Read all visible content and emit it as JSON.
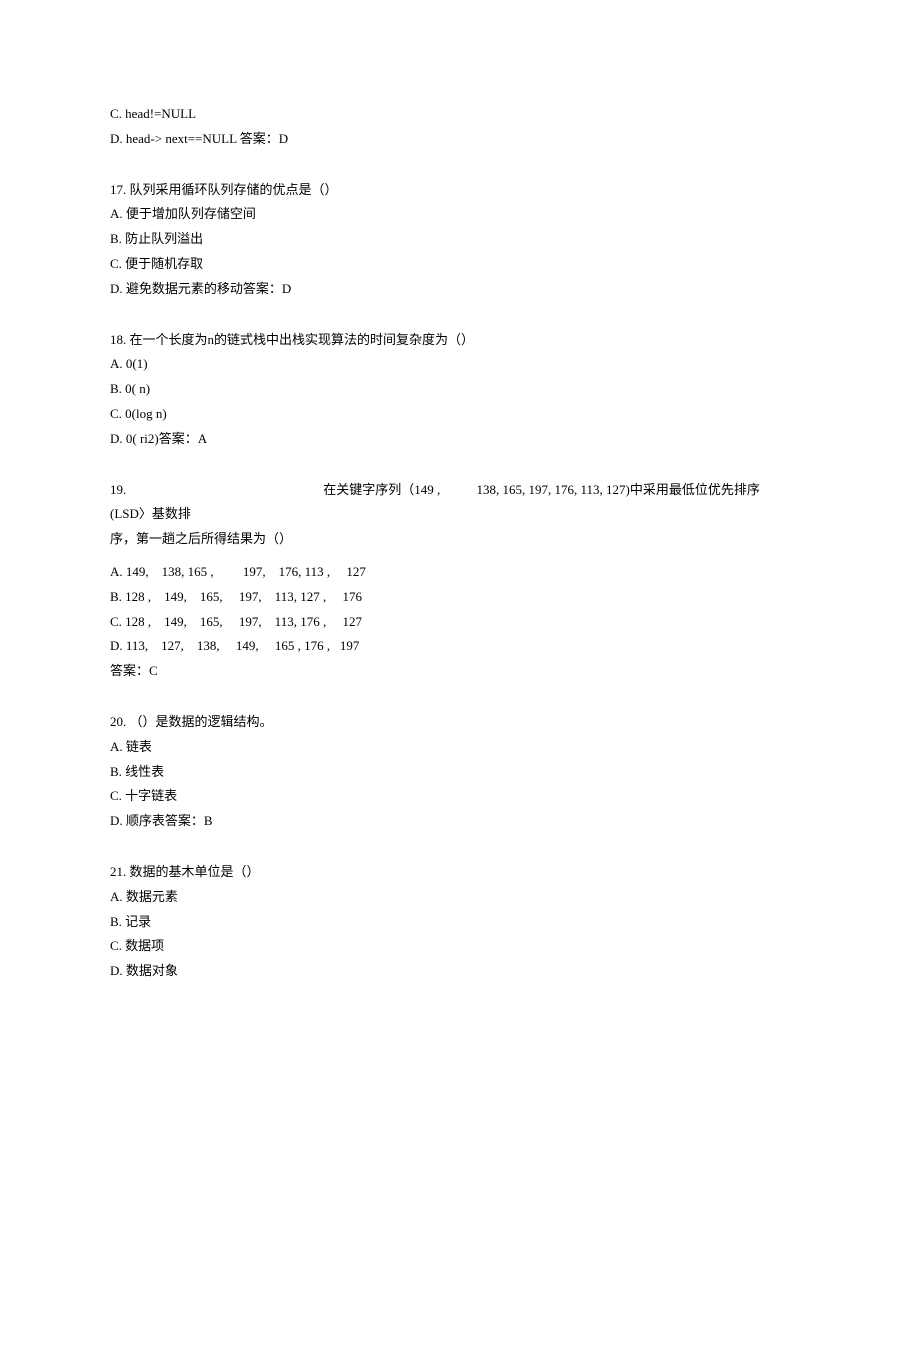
{
  "q16": {
    "optC": "C.   head!=NULL",
    "optD": "D.   head-> next==NULL 答案：D"
  },
  "q17": {
    "stem": "17.        队列采用循环队列存储的优点是（）",
    "optA": "A.   便于增加队列存储空间",
    "optB": "B.   防止队列溢出",
    "optC": "C.   便于随机存取",
    "optD": "D.   避免数据元素的移动答案：D"
  },
  "q18": {
    "stem": "18.        在一个长度为n的链式栈中出栈实现算法的时间复杂度为（）",
    "optA": "A.   0(1)",
    "optB": "B.   0( n)",
    "optC": "C.   0(log n)",
    "optD": "D.   0( ri2)答案：A"
  },
  "q19": {
    "stemLine1a": "19.",
    "stemLine1b": "在关键字序列（149 ,",
    "stemLine1c": "138,   165,   197,   176,   113,   127)中采用最低位优先排序",
    "stemLine2": "(LSD〉基数排",
    "stemLine3": "序，第一趟之后所得结果为（）",
    "optA": "A. 149,    138, 165 ,         197,    176, 113 ,     127",
    "optB": "B. 128 ,    149,    165,     197,    113, 127 ,     176",
    "optC": "C. 128 ,    149,    165,     197,    113, 176 ,     127",
    "optD": "D. 113,    127,    138,     149,     165 , 176 ,   197",
    "answer": "答案：C"
  },
  "q20": {
    "stem": "20.     （）是数据的逻辑结构。",
    "optA": "A.   链表",
    "optB": "B.   线性表",
    "optC": "C.   十字链表",
    "optD": "D.   顺序表答案：B"
  },
  "q21": {
    "stem": "21.      数据的基木单位是（）",
    "optA": "A.   数据元素",
    "optB": "B.   记录",
    "optC": "C.   数据项",
    "optD": "D.   数据对象"
  }
}
